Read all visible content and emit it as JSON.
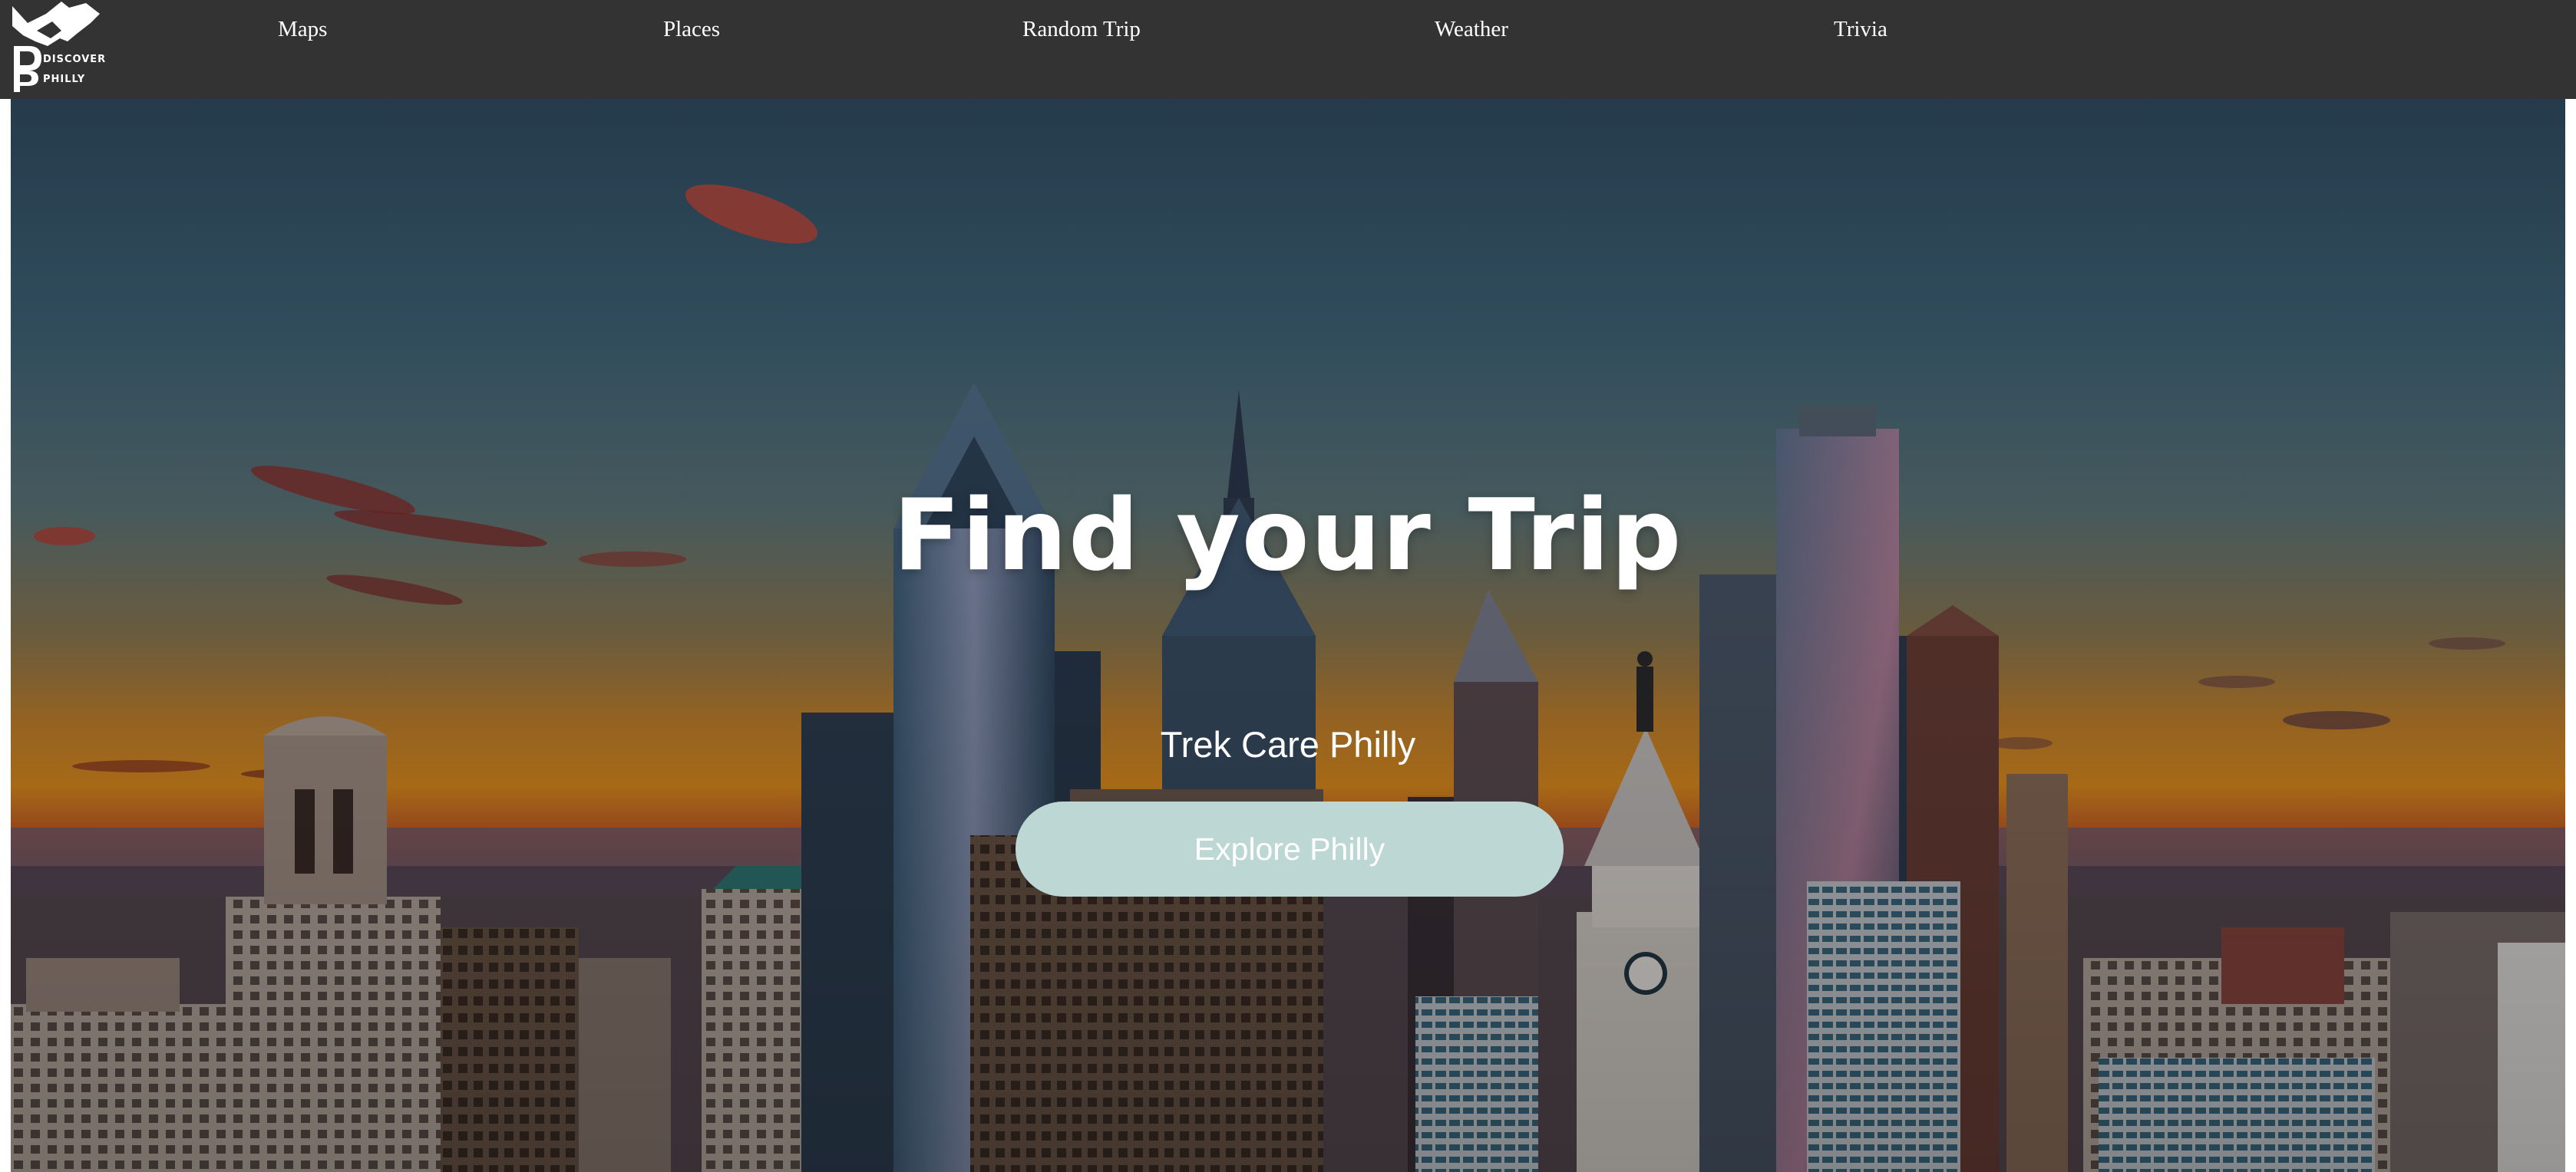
{
  "brand": {
    "logo_text_line1": "DISCOVER",
    "logo_text_line2": "PHILLY",
    "logo_letters": "DP"
  },
  "nav": {
    "items": [
      {
        "label": "Maps"
      },
      {
        "label": "Places"
      },
      {
        "label": "Random Trip"
      },
      {
        "label": "Weather"
      },
      {
        "label": "Trivia"
      }
    ]
  },
  "hero": {
    "title": "Find your Trip",
    "subtitle": "Trek Care Philly",
    "cta_label": "Explore Philly",
    "background_image": "philadelphia-skyline-sunset"
  },
  "colors": {
    "navbar": "#333333",
    "nav_text": "#ffffff",
    "cta_background": "#bdd8d4",
    "cta_text": "#ffffff",
    "sky_top": "#2d4a60",
    "sunset": "#e38a27"
  }
}
